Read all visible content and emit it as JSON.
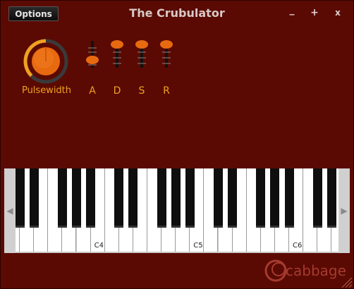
{
  "window": {
    "title": "The Crubulator",
    "controls": {
      "minimize": "_",
      "maximize": "+",
      "close": "x"
    }
  },
  "options_button": {
    "label": "Options"
  },
  "knob": {
    "label": "Pulsewidth",
    "value_fraction": 0.5
  },
  "envelope": [
    {
      "label": "A",
      "value_fraction": 0.35
    },
    {
      "label": "D",
      "value_fraction": 1.0
    },
    {
      "label": "S",
      "value_fraction": 1.0
    },
    {
      "label": "R",
      "value_fraction": 1.0
    }
  ],
  "keyboard": {
    "left_arrow": "◀",
    "right_arrow": "▶",
    "octave_labels": [
      "C4",
      "C5",
      "C6"
    ]
  },
  "logo": {
    "text": "cabbage"
  },
  "colors": {
    "background": "#5a0a02",
    "accent": "#f0a020",
    "knob": "#e86a10"
  }
}
